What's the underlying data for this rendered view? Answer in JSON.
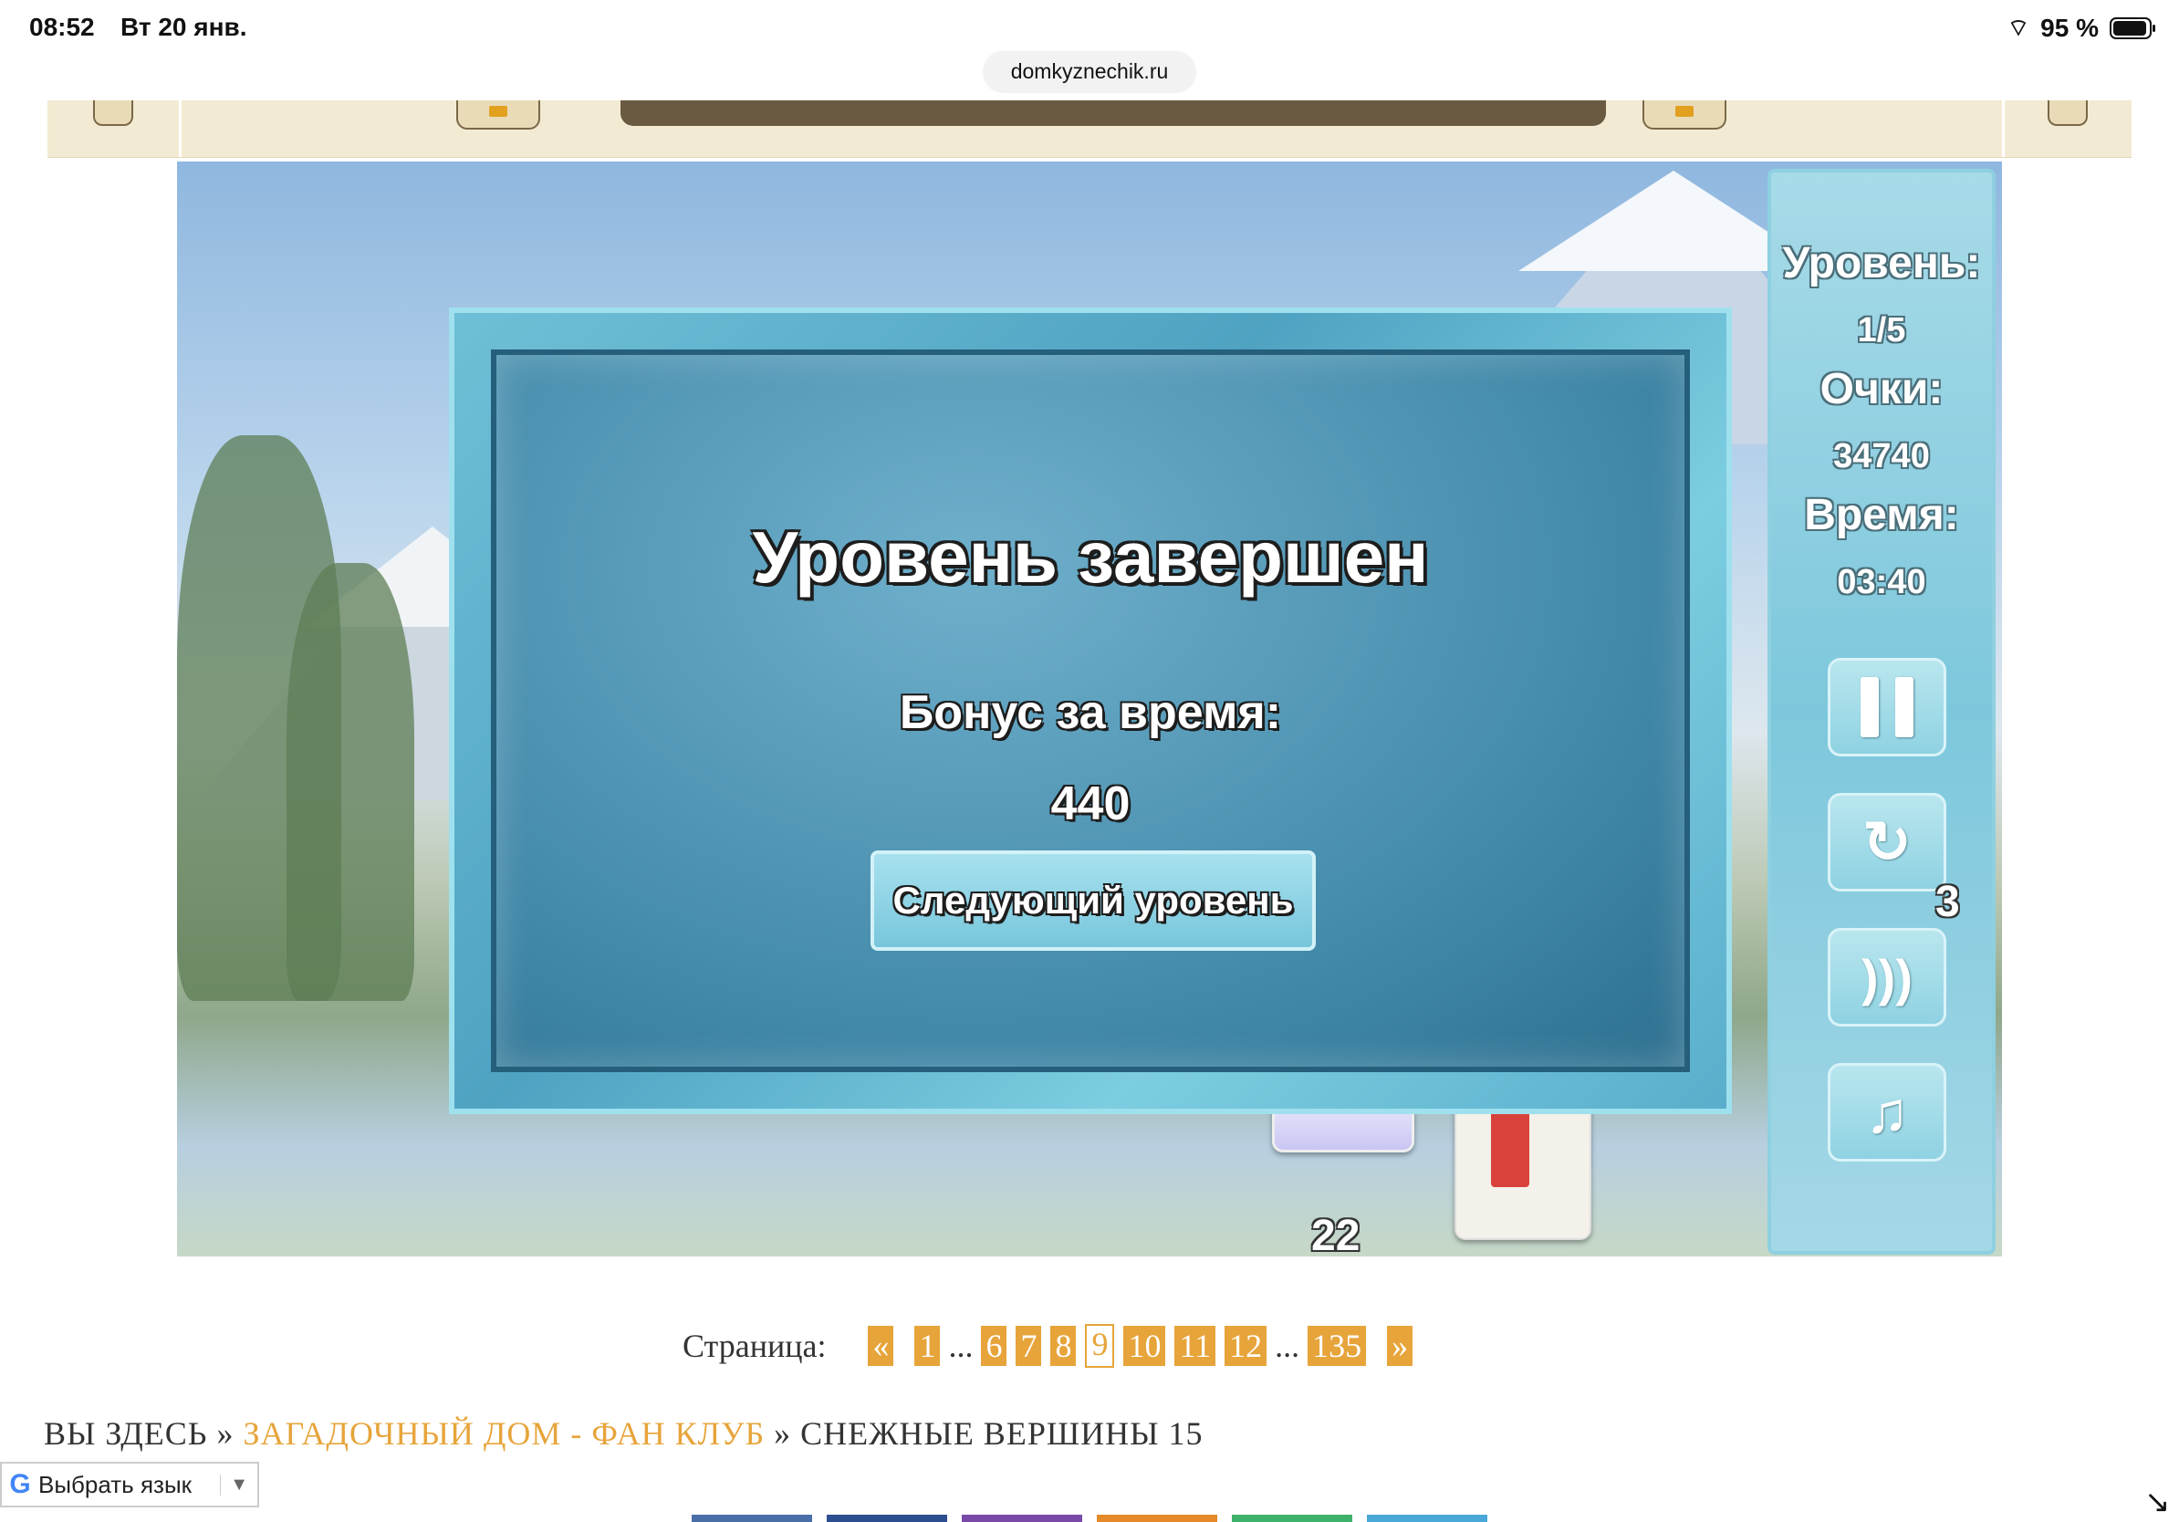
{
  "status_bar": {
    "time": "08:52",
    "date": "Вт 20 янв.",
    "battery": "95 %"
  },
  "browser": {
    "url": "domkyznechik.ru"
  },
  "game": {
    "panel": {
      "level_label": "Уровень:",
      "level_value": "1/5",
      "score_label": "Очки:",
      "score_value": "34740",
      "time_label": "Время:",
      "time_value": "03:40",
      "restart_count": "3"
    },
    "deck_count": "22",
    "modal": {
      "title": "Уровень завершен",
      "bonus_label": "Бонус за время:",
      "bonus_value": "440",
      "next_button": "Следующий уровень"
    }
  },
  "pagination": {
    "label": "Страница:",
    "prev": "«",
    "next": "»",
    "ellipsis": "...",
    "pages": [
      "1",
      "6",
      "7",
      "8",
      "9",
      "10",
      "11",
      "12",
      "135"
    ],
    "current": "9"
  },
  "breadcrumb": {
    "prefix": "ВЫ ЗДЕСЬ",
    "sep": "»",
    "link": "ЗАГАДОЧНЫЙ ДОМ - ФАН КЛУБ",
    "current": "СНЕЖНЫЕ ВЕРШИНЫ 15"
  },
  "translate": {
    "label": "Выбрать язык",
    "arrow": "▼"
  },
  "colors": {
    "accent": "#e7a43a",
    "ice": "#7dc7dc",
    "modal_dark": "#3f86a6"
  }
}
